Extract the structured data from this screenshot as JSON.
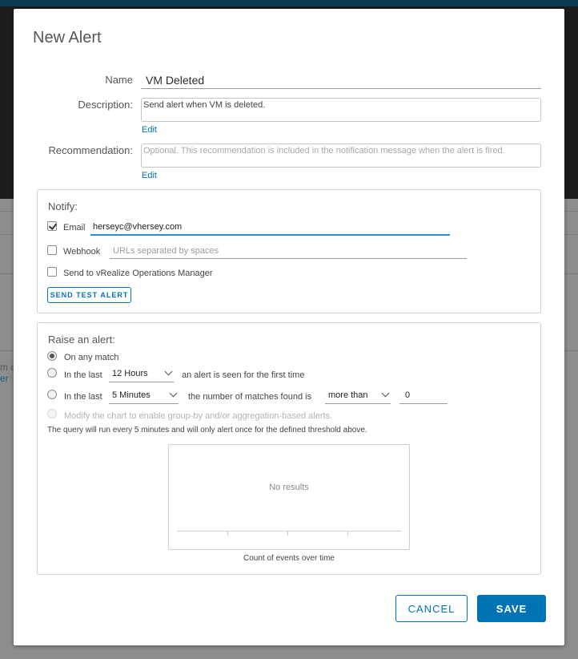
{
  "background": {
    "fragment_1": "m or",
    "fragment_2": "er"
  },
  "dialog": {
    "title": "New Alert",
    "name": {
      "label": "Name",
      "value": "VM Deleted"
    },
    "description": {
      "label": "Description:",
      "value": "Send alert when VM is deleted.",
      "edit_link": "Edit"
    },
    "recommendation": {
      "label": "Recommendation:",
      "placeholder": "Optional. This recommendation is included in the notification message when the alert is fired.",
      "edit_link": "Edit"
    },
    "notify": {
      "title": "Notify:",
      "email": {
        "label": "Email",
        "checked": true,
        "value": "herseyc@vhersey.com"
      },
      "webhook": {
        "label": "Webhook",
        "checked": false,
        "placeholder": "URLs separated by spaces"
      },
      "vrops": {
        "label": "Send to vRealize Operations Manager",
        "checked": false
      },
      "test_button": "SEND TEST ALERT"
    },
    "raise": {
      "title": "Raise an alert:",
      "option_any": {
        "label": "On any match",
        "selected": true
      },
      "option_first": {
        "prefix": "In the last",
        "window": "12 Hours",
        "suffix": "an alert is seen for the first time",
        "selected": false
      },
      "option_threshold": {
        "prefix": "In the last",
        "window": "5 Minutes",
        "middle": "the number of matches found is",
        "comparator": "more than",
        "value": "0",
        "selected": false
      },
      "option_disabled": "Modify the chart to enable group-by and/or aggregation-based alerts.",
      "note": "The query will run every 5 minutes and will only alert once for the defined threshold above.",
      "chart": {
        "empty_text": "No results",
        "caption": "Count of events over time"
      }
    },
    "buttons": {
      "cancel": "CANCEL",
      "save": "SAVE"
    }
  },
  "colors": {
    "accent": "#0073b5",
    "focus_underline": "#2a8fd1",
    "header_bar": "#0a3d52"
  }
}
